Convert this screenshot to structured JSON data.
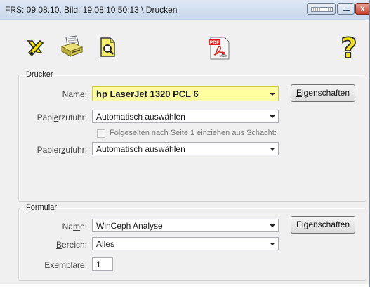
{
  "window": {
    "title": "FRS: 09.08.10,  Bild: 19.08.10  50:13 \\ Drucken",
    "close_glyph": "x"
  },
  "toolbar": {
    "icons": [
      "cancel-icon",
      "print-icon",
      "print-preview-icon",
      "pdf-mdx-icon",
      "help-icon"
    ],
    "pdf_label": "PDF",
    "pdf_sublabel": "Mdx",
    "help_glyph": "?"
  },
  "printer_group": {
    "legend": "Drucker",
    "name_label_pre": "",
    "name_label_key": "N",
    "name_label_post": "ame:",
    "name_value": "hp LaserJet 1320 PCL 6",
    "properties_pre": "",
    "properties_key": "E",
    "properties_post": "igenschaften",
    "feed1_label_pre": "Papi",
    "feed1_label_key": "e",
    "feed1_label_post": "rzufuhr:",
    "feed1_value": "Automatisch auswählen",
    "checkbox_label": "Folgeseiten nach Seite 1 einziehen aus Schacht:",
    "checkbox_checked": false,
    "feed2_label_pre": "Papier",
    "feed2_label_key": "z",
    "feed2_label_post": "ufuhr:",
    "feed2_value": "Automatisch auswählen"
  },
  "form_group": {
    "legend": "Formular",
    "name_label_pre": "Na",
    "name_label_key": "m",
    "name_label_post": "e:",
    "name_value": "WinCeph Analyse",
    "properties_pre": "Ei",
    "properties_key": "g",
    "properties_post": "enschaften",
    "range_label_pre": "",
    "range_label_key": "B",
    "range_label_post": "ereich:",
    "range_value": "Alles",
    "copies_label_pre": "E",
    "copies_label_key": "x",
    "copies_label_post": "emplare:",
    "copies_value": "1"
  },
  "colors": {
    "highlight_field": "#ffff9f",
    "window_bg": "#f0f0f0",
    "titlebar": "#c6d6ea",
    "close_button": "#c7412b"
  }
}
